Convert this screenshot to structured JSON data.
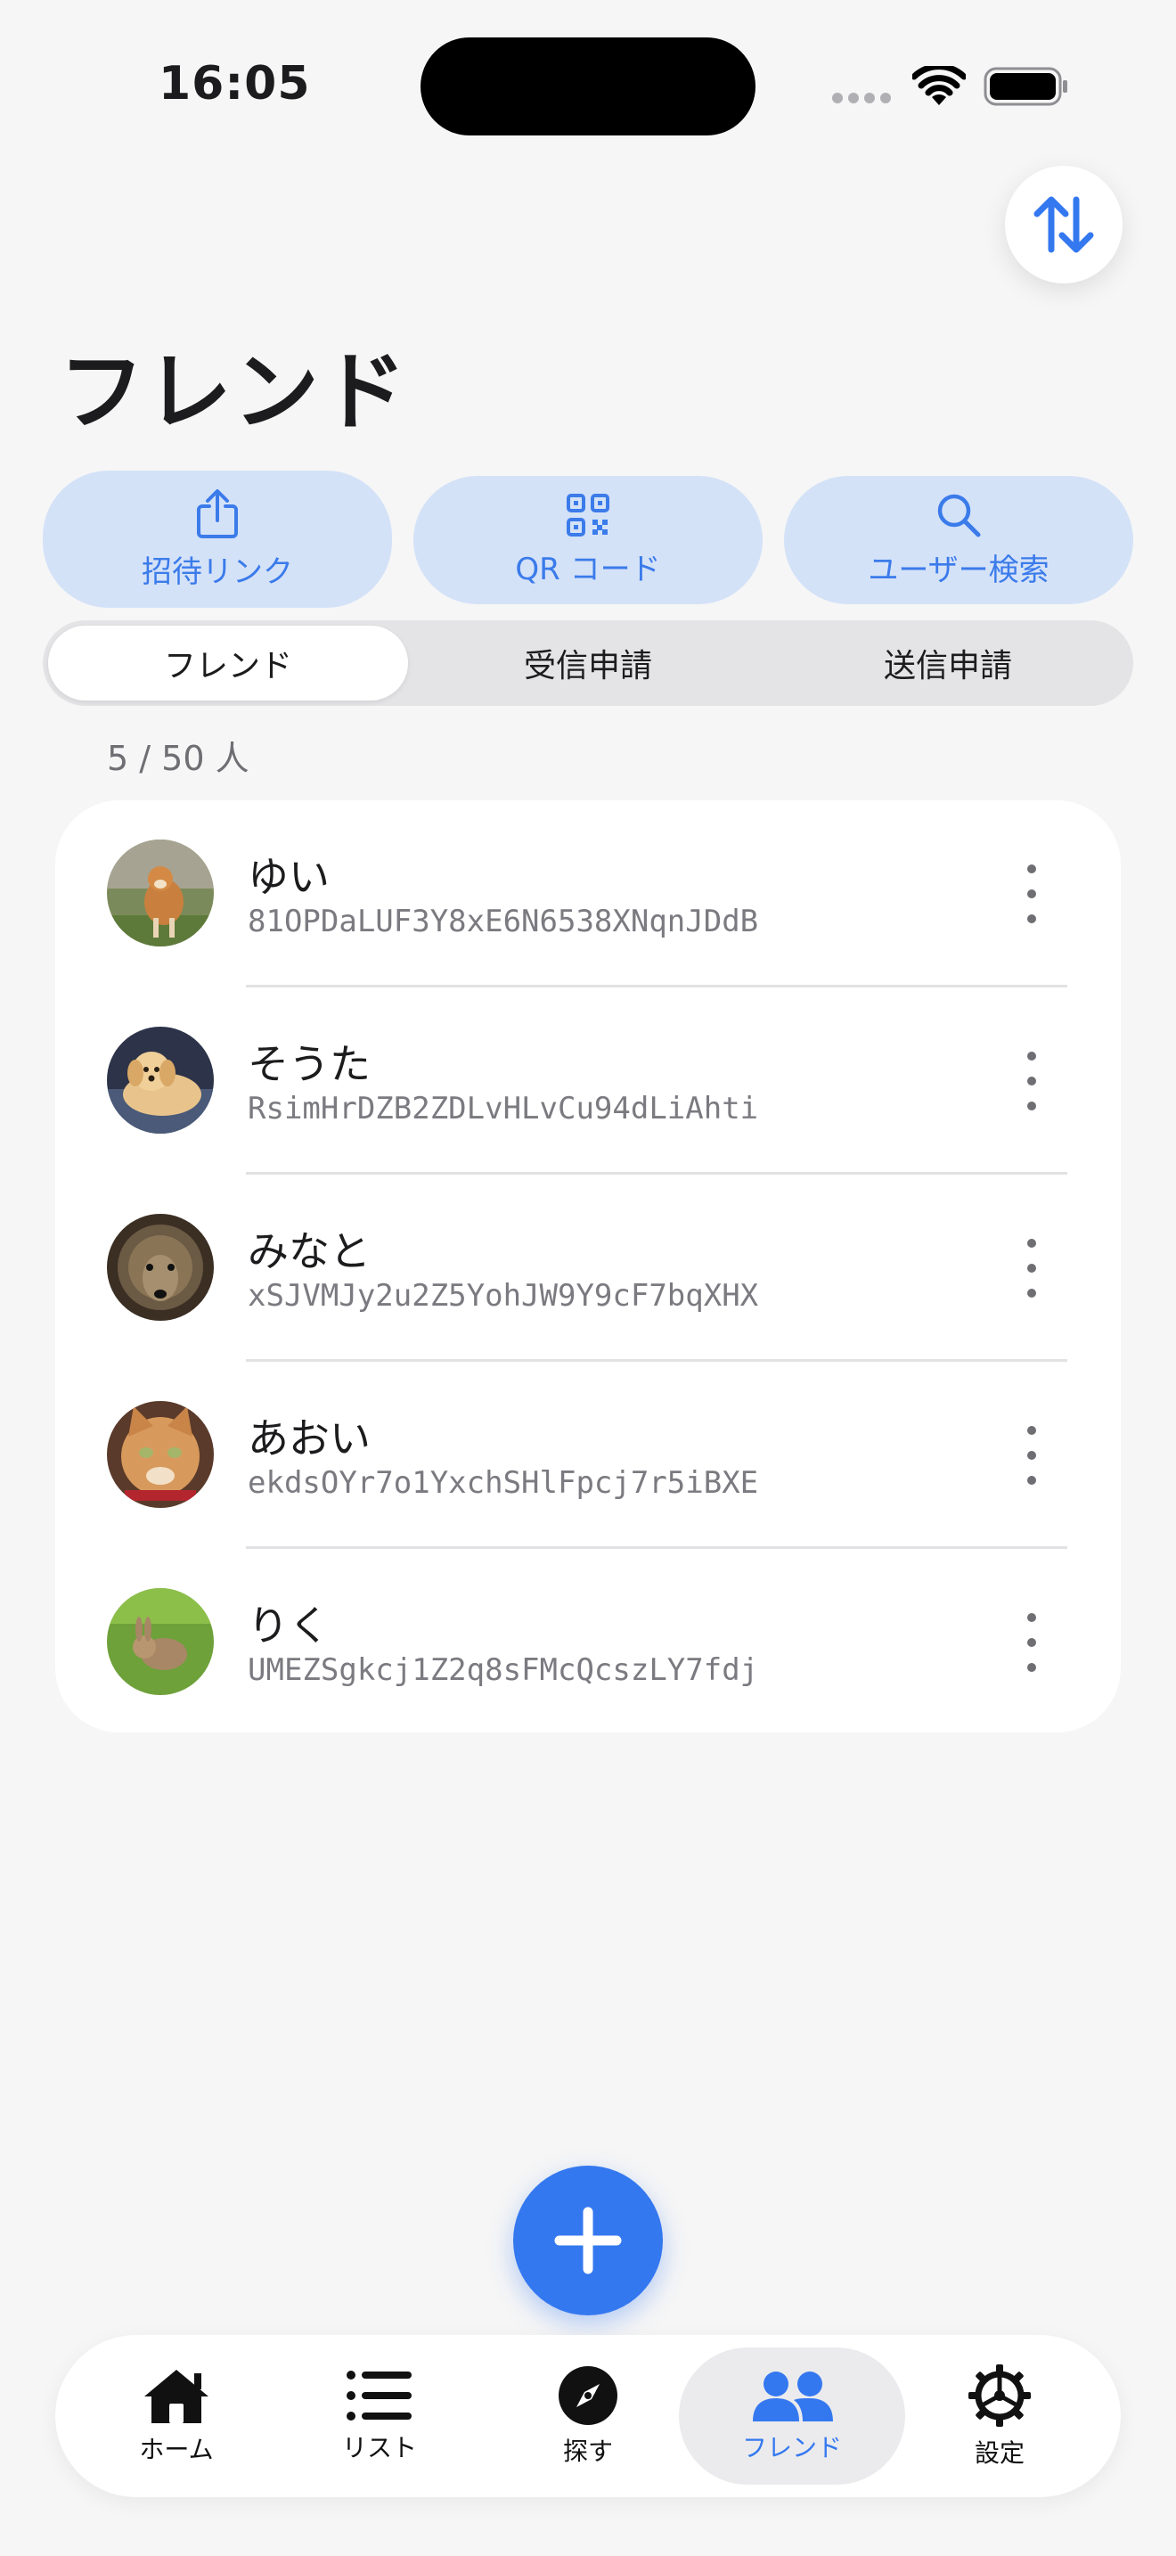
{
  "status_bar": {
    "time": "16:05"
  },
  "page": {
    "title": "フレンド"
  },
  "actions": {
    "invite_link": "招待リンク",
    "qr_code": "QR コード",
    "user_search": "ユーザー検索"
  },
  "segments": [
    {
      "label": "フレンド",
      "active": true
    },
    {
      "label": "受信申請",
      "active": false
    },
    {
      "label": "送信申請",
      "active": false
    }
  ],
  "friend_count": "5 / 50 人",
  "friends": [
    {
      "name": "ゆい",
      "id": "81OPDaLUF3Y8xE6N6538XNqnJDdB",
      "avatar": "shiba-dog"
    },
    {
      "name": "そうた",
      "id": "RsimHrDZB2ZDLvHLvCu94dLiAhti",
      "avatar": "golden-puppy"
    },
    {
      "name": "みなと",
      "id": "xSJVMJy2u2Z5YohJW9Y9cF7bqXHX",
      "avatar": "hedgehog"
    },
    {
      "name": "あおい",
      "id": "ekdsOYr7o1YxchSHlFpcj7r5iBXE",
      "avatar": "orange-cat"
    },
    {
      "name": "りく",
      "id": "UMEZSgkcj1Z2q8sFMcQcszLY7fdj",
      "avatar": "rabbit-grass"
    }
  ],
  "tabs": [
    {
      "label": "ホーム",
      "icon": "house-icon",
      "active": false
    },
    {
      "label": "リスト",
      "icon": "list-icon",
      "active": false
    },
    {
      "label": "探す",
      "icon": "compass-icon",
      "active": false
    },
    {
      "label": "フレンド",
      "icon": "people-icon",
      "active": true
    },
    {
      "label": "設定",
      "icon": "gear-icon",
      "active": false
    }
  ],
  "colors": {
    "accent": "#3478f0",
    "action_bg": "#d4e2f8",
    "background": "#f6f6f6"
  }
}
